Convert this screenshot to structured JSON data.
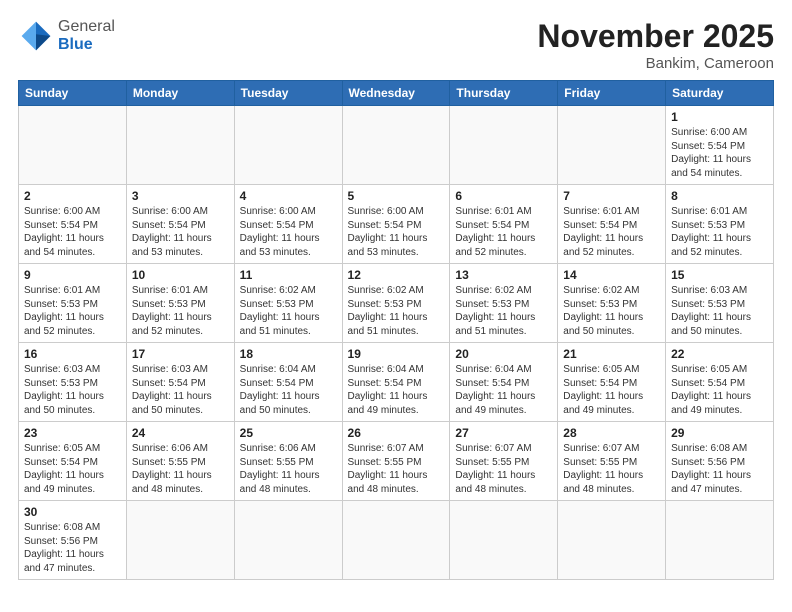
{
  "header": {
    "logo_general": "General",
    "logo_blue": "Blue",
    "month_year": "November 2025",
    "location": "Bankim, Cameroon"
  },
  "weekdays": [
    "Sunday",
    "Monday",
    "Tuesday",
    "Wednesday",
    "Thursday",
    "Friday",
    "Saturday"
  ],
  "weeks": [
    [
      {
        "day": "",
        "info": ""
      },
      {
        "day": "",
        "info": ""
      },
      {
        "day": "",
        "info": ""
      },
      {
        "day": "",
        "info": ""
      },
      {
        "day": "",
        "info": ""
      },
      {
        "day": "",
        "info": ""
      },
      {
        "day": "1",
        "info": "Sunrise: 6:00 AM\nSunset: 5:54 PM\nDaylight: 11 hours\nand 54 minutes."
      }
    ],
    [
      {
        "day": "2",
        "info": "Sunrise: 6:00 AM\nSunset: 5:54 PM\nDaylight: 11 hours\nand 54 minutes."
      },
      {
        "day": "3",
        "info": "Sunrise: 6:00 AM\nSunset: 5:54 PM\nDaylight: 11 hours\nand 53 minutes."
      },
      {
        "day": "4",
        "info": "Sunrise: 6:00 AM\nSunset: 5:54 PM\nDaylight: 11 hours\nand 53 minutes."
      },
      {
        "day": "5",
        "info": "Sunrise: 6:00 AM\nSunset: 5:54 PM\nDaylight: 11 hours\nand 53 minutes."
      },
      {
        "day": "6",
        "info": "Sunrise: 6:01 AM\nSunset: 5:54 PM\nDaylight: 11 hours\nand 52 minutes."
      },
      {
        "day": "7",
        "info": "Sunrise: 6:01 AM\nSunset: 5:54 PM\nDaylight: 11 hours\nand 52 minutes."
      },
      {
        "day": "8",
        "info": "Sunrise: 6:01 AM\nSunset: 5:53 PM\nDaylight: 11 hours\nand 52 minutes."
      }
    ],
    [
      {
        "day": "9",
        "info": "Sunrise: 6:01 AM\nSunset: 5:53 PM\nDaylight: 11 hours\nand 52 minutes."
      },
      {
        "day": "10",
        "info": "Sunrise: 6:01 AM\nSunset: 5:53 PM\nDaylight: 11 hours\nand 52 minutes."
      },
      {
        "day": "11",
        "info": "Sunrise: 6:02 AM\nSunset: 5:53 PM\nDaylight: 11 hours\nand 51 minutes."
      },
      {
        "day": "12",
        "info": "Sunrise: 6:02 AM\nSunset: 5:53 PM\nDaylight: 11 hours\nand 51 minutes."
      },
      {
        "day": "13",
        "info": "Sunrise: 6:02 AM\nSunset: 5:53 PM\nDaylight: 11 hours\nand 51 minutes."
      },
      {
        "day": "14",
        "info": "Sunrise: 6:02 AM\nSunset: 5:53 PM\nDaylight: 11 hours\nand 50 minutes."
      },
      {
        "day": "15",
        "info": "Sunrise: 6:03 AM\nSunset: 5:53 PM\nDaylight: 11 hours\nand 50 minutes."
      }
    ],
    [
      {
        "day": "16",
        "info": "Sunrise: 6:03 AM\nSunset: 5:53 PM\nDaylight: 11 hours\nand 50 minutes."
      },
      {
        "day": "17",
        "info": "Sunrise: 6:03 AM\nSunset: 5:54 PM\nDaylight: 11 hours\nand 50 minutes."
      },
      {
        "day": "18",
        "info": "Sunrise: 6:04 AM\nSunset: 5:54 PM\nDaylight: 11 hours\nand 50 minutes."
      },
      {
        "day": "19",
        "info": "Sunrise: 6:04 AM\nSunset: 5:54 PM\nDaylight: 11 hours\nand 49 minutes."
      },
      {
        "day": "20",
        "info": "Sunrise: 6:04 AM\nSunset: 5:54 PM\nDaylight: 11 hours\nand 49 minutes."
      },
      {
        "day": "21",
        "info": "Sunrise: 6:05 AM\nSunset: 5:54 PM\nDaylight: 11 hours\nand 49 minutes."
      },
      {
        "day": "22",
        "info": "Sunrise: 6:05 AM\nSunset: 5:54 PM\nDaylight: 11 hours\nand 49 minutes."
      }
    ],
    [
      {
        "day": "23",
        "info": "Sunrise: 6:05 AM\nSunset: 5:54 PM\nDaylight: 11 hours\nand 49 minutes."
      },
      {
        "day": "24",
        "info": "Sunrise: 6:06 AM\nSunset: 5:55 PM\nDaylight: 11 hours\nand 48 minutes."
      },
      {
        "day": "25",
        "info": "Sunrise: 6:06 AM\nSunset: 5:55 PM\nDaylight: 11 hours\nand 48 minutes."
      },
      {
        "day": "26",
        "info": "Sunrise: 6:07 AM\nSunset: 5:55 PM\nDaylight: 11 hours\nand 48 minutes."
      },
      {
        "day": "27",
        "info": "Sunrise: 6:07 AM\nSunset: 5:55 PM\nDaylight: 11 hours\nand 48 minutes."
      },
      {
        "day": "28",
        "info": "Sunrise: 6:07 AM\nSunset: 5:55 PM\nDaylight: 11 hours\nand 48 minutes."
      },
      {
        "day": "29",
        "info": "Sunrise: 6:08 AM\nSunset: 5:56 PM\nDaylight: 11 hours\nand 47 minutes."
      }
    ],
    [
      {
        "day": "30",
        "info": "Sunrise: 6:08 AM\nSunset: 5:56 PM\nDaylight: 11 hours\nand 47 minutes."
      },
      {
        "day": "",
        "info": ""
      },
      {
        "day": "",
        "info": ""
      },
      {
        "day": "",
        "info": ""
      },
      {
        "day": "",
        "info": ""
      },
      {
        "day": "",
        "info": ""
      },
      {
        "day": "",
        "info": ""
      }
    ]
  ]
}
